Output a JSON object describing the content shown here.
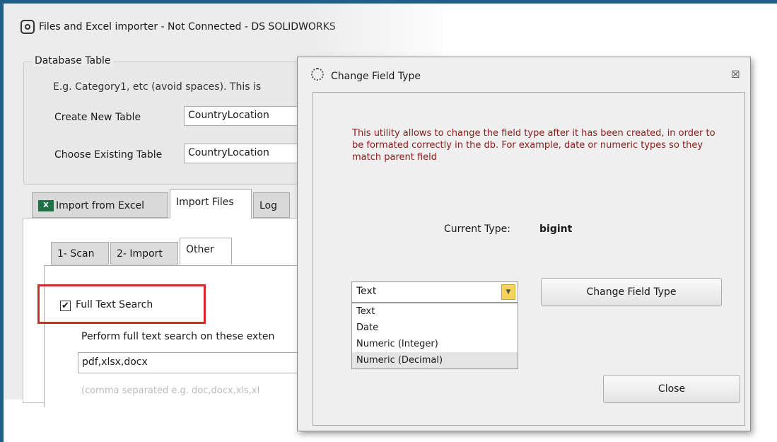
{
  "main_window": {
    "title": "Files and Excel importer   - Not Connected - DS SOLIDWORKS",
    "database_table": {
      "legend": "Database Table",
      "hint": "E.g. Category1, etc (avoid spaces). This is",
      "create_label": "Create New Table",
      "create_value": "CountryLocation",
      "choose_label": "Choose Existing Table",
      "choose_value": "CountryLocation"
    },
    "tabs": [
      {
        "label": "Import from Excel",
        "icon": "excel-icon"
      },
      {
        "label": "Import Files",
        "active": true
      },
      {
        "label": "Log"
      }
    ],
    "subtabs": [
      {
        "label": "1- Scan"
      },
      {
        "label": "2- Import"
      },
      {
        "label": "Other",
        "active": true
      }
    ],
    "full_text": {
      "checkbox_label": "Full Text Search",
      "checked": "✔",
      "perform_label": "Perform full text search on these exten",
      "extensions_value": "pdf,xlsx,docx",
      "note": "(comma separated e.g. doc,docx,xls,xl"
    }
  },
  "dialog": {
    "title": "Change Field Type",
    "close_glyph": "☒",
    "description": "This utility allows to change the field type after it has been created, in order to be formated correctly in the db. For example, date or numeric types so they match parent field",
    "current_type_label": "Current Type:",
    "current_type_value": "bigint",
    "combo_value": "Text",
    "options": [
      "Text",
      "Date",
      "Numeric (Integer)",
      "Numeric (Decimal)"
    ],
    "change_button": "Change Field Type",
    "close_button": "Close"
  }
}
